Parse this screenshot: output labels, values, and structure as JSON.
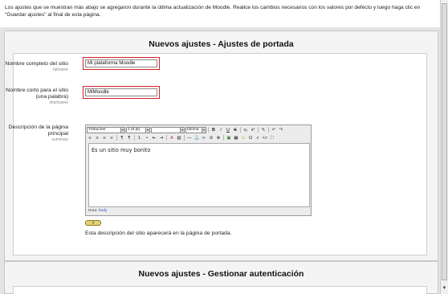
{
  "intro": {
    "line1": "Los ajustes que se muestran más abajo se agregaron durante la última actualización de Moodle. Realice los cambios necesarios con los valores por defecto y luego haga clic en",
    "line2": "\"Guardar ajustes\" al final de esta página."
  },
  "section1": {
    "title": "Nuevos ajustes - Ajustes de portada",
    "fullname": {
      "label": "Nombre completo del sitio",
      "key": "fullname",
      "value": "Mi plataforma Moodle"
    },
    "shortname": {
      "label_line1": "Nombre corto para el sitio",
      "label_line2": "(una palabra)",
      "key": "shortname",
      "value": "MiMoodle"
    },
    "summary": {
      "label_line1": "Descripción de la página",
      "label_line2": "principal",
      "key": "summary",
      "editor": {
        "font_select": "Trebuchet",
        "size_select": "1 (8 pt)",
        "style_select": "",
        "lang_select": "Idioma",
        "content": "Es un sitio muy bonito",
        "path_label": "Ruta:",
        "path_value": "body"
      },
      "help_label": "?",
      "note": "Esta descripción del sitio aparecerá en la página de portada."
    }
  },
  "section2": {
    "title": "Nuevos ajustes - Gestionar autenticación"
  },
  "colors": {
    "highlight": "#d11f2a",
    "page_bg": "#e4e4e4",
    "panel_bg": "#f4f4f4"
  }
}
